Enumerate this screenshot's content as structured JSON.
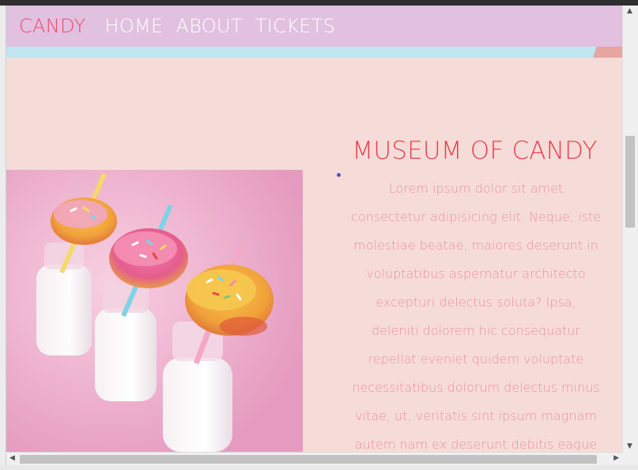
{
  "nav": {
    "brand": "CANDY",
    "links": [
      "HOME",
      "ABOUT",
      "TICKETS"
    ]
  },
  "section": {
    "title": "MUSEUM OF CANDY",
    "body": "Lorem ipsum dolor sit amet consectetur adipisicing elit. Neque, iste molestiae beatae, maiores deserunt in voluptatibus aspernatur architecto excepturi delectus soluta? Ipsa, deleniti dolorem hic consequatur repellat eveniet quidem voluptate necessitatibus dolorum delectus minus vitae, ut, veritatis sint ipsum magnam autem nam ex deserunt debitis eaque"
  },
  "image": {
    "description_icon": "donuts-on-milk-bottles-photo"
  },
  "scrollbars": {
    "up": "▲",
    "down": "▼",
    "left": "◀",
    "right": "▶"
  },
  "colors": {
    "page_bg": "#f6dcd8",
    "nav_bg": "#e1c0e0",
    "brand": "#ef4b6a",
    "nav_link": "#ffffff",
    "band": "#bfe6f1",
    "title": "#e8404f",
    "body_text": "#eb8fa6"
  }
}
